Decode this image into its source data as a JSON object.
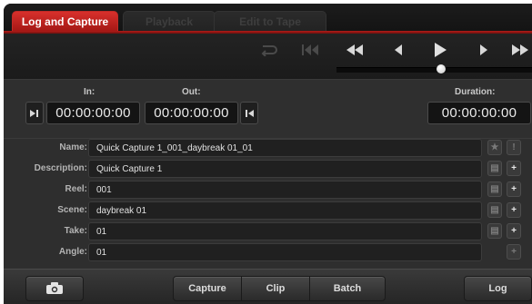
{
  "tabs": [
    {
      "label": "Log and Capture",
      "active": true
    },
    {
      "label": "Playback",
      "active": false
    },
    {
      "label": "Edit to Tape",
      "active": false
    }
  ],
  "transport": {
    "icons": [
      "loop-icon",
      "go-to-start-icon",
      "rewind-icon",
      "step-back-icon",
      "play-icon",
      "step-forward-icon",
      "fast-forward-icon"
    ]
  },
  "timecode": {
    "in_label": "In:",
    "in_value": "00:00:00:00",
    "out_label": "Out:",
    "out_value": "00:00:00:00",
    "duration_label": "Duration:",
    "duration_value": "00:00:00:00"
  },
  "metadata": {
    "name": {
      "label": "Name:",
      "value": "Quick Capture 1_001_daybreak 01_01"
    },
    "description": {
      "label": "Description:",
      "value": "Quick Capture 1"
    },
    "reel": {
      "label": "Reel:",
      "value": "001"
    },
    "scene": {
      "label": "Scene:",
      "value": "daybreak 01"
    },
    "take": {
      "label": "Take:",
      "value": "01"
    },
    "angle": {
      "label": "Angle:",
      "value": "01"
    },
    "name_buttons": [
      "★",
      "!"
    ],
    "plus": "+"
  },
  "toolbar": {
    "capture": "Capture",
    "clip": "Clip",
    "batch": "Batch",
    "log": "Log"
  },
  "colors": {
    "accent_red": "#c8221e",
    "panel": "#2e2e2e"
  }
}
